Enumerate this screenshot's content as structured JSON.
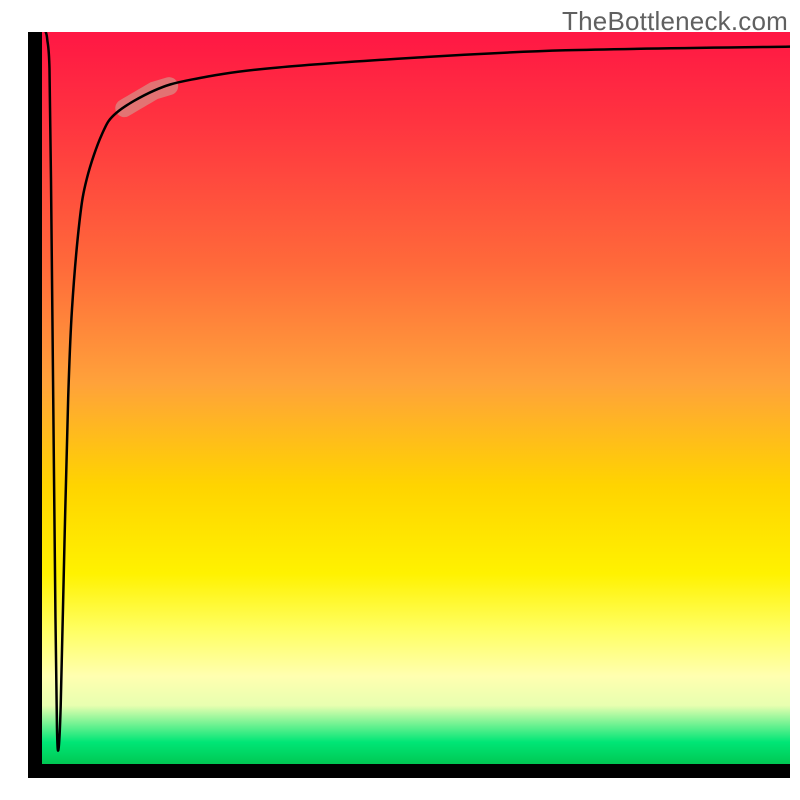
{
  "watermark": "TheBottleneck.com",
  "chart_data": {
    "type": "line",
    "title": "",
    "xlabel": "",
    "ylabel": "",
    "xlim": [
      0,
      100
    ],
    "ylim": [
      0,
      100
    ],
    "grid": false,
    "legend": false,
    "background_gradient": {
      "orientation": "vertical_top_to_bottom",
      "stops": [
        {
          "pos": 0.0,
          "color": "#ff1744"
        },
        {
          "pos": 0.12,
          "color": "#ff3340"
        },
        {
          "pos": 0.32,
          "color": "#ff6a3a"
        },
        {
          "pos": 0.48,
          "color": "#ffa23a"
        },
        {
          "pos": 0.62,
          "color": "#ffd400"
        },
        {
          "pos": 0.74,
          "color": "#fff200"
        },
        {
          "pos": 0.82,
          "color": "#ffff66"
        },
        {
          "pos": 0.88,
          "color": "#ffffb0"
        },
        {
          "pos": 0.92,
          "color": "#e8ffb0"
        },
        {
          "pos": 0.97,
          "color": "#00e676"
        },
        {
          "pos": 1.0,
          "color": "#00c853"
        }
      ]
    },
    "series": [
      {
        "name": "curve",
        "stroke": "#000000",
        "stroke_width": 2.5,
        "points": [
          {
            "x": 0.5,
            "y": 100
          },
          {
            "x": 0.7,
            "y": 99
          },
          {
            "x": 1.0,
            "y": 95
          },
          {
            "x": 1.2,
            "y": 80
          },
          {
            "x": 1.5,
            "y": 50
          },
          {
            "x": 1.8,
            "y": 20
          },
          {
            "x": 2.0,
            "y": 5
          },
          {
            "x": 2.2,
            "y": 2
          },
          {
            "x": 2.5,
            "y": 8
          },
          {
            "x": 3.0,
            "y": 30
          },
          {
            "x": 3.5,
            "y": 50
          },
          {
            "x": 4.0,
            "y": 62
          },
          {
            "x": 5.0,
            "y": 74
          },
          {
            "x": 6.0,
            "y": 80
          },
          {
            "x": 8.0,
            "y": 86
          },
          {
            "x": 10.0,
            "y": 89
          },
          {
            "x": 15.0,
            "y": 92
          },
          {
            "x": 20.0,
            "y": 93.5
          },
          {
            "x": 30.0,
            "y": 95
          },
          {
            "x": 50.0,
            "y": 96.5
          },
          {
            "x": 70.0,
            "y": 97.5
          },
          {
            "x": 100.0,
            "y": 98
          }
        ]
      }
    ],
    "highlight_segment": {
      "on_series": "curve",
      "x_start": 11,
      "x_end": 17,
      "color": "#d98b84",
      "opacity": 0.75,
      "width": 18
    }
  }
}
